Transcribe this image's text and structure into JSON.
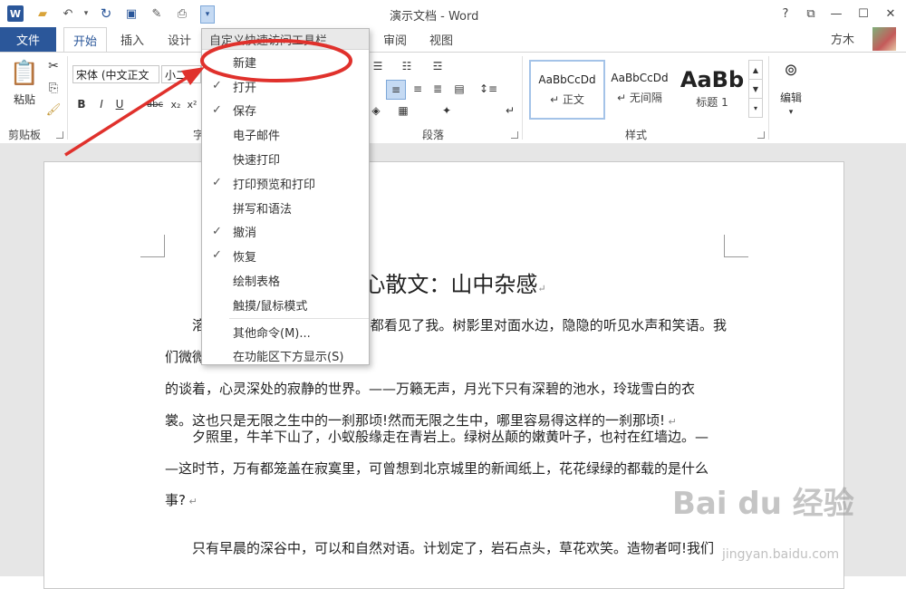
{
  "window": {
    "title": "演示文档 - Word",
    "user": "方木"
  },
  "tabs": {
    "file": "文件",
    "items": [
      "开始",
      "插入",
      "设计",
      "审阅",
      "视图"
    ],
    "active": "开始"
  },
  "ribbon": {
    "paste_label": "粘贴",
    "font_name": "宋体 (中文正文",
    "font_size": "小二",
    "groups": {
      "clipboard": "剪贴板",
      "font": "字",
      "paragraph": "段落",
      "styles": "样式"
    },
    "styles": [
      {
        "sample": "AaBbCcDd",
        "name": "↵ 正文"
      },
      {
        "sample": "AaBbCcDd",
        "name": "↵ 无间隔"
      },
      {
        "sample": "AaBb",
        "name": "标题 1"
      }
    ],
    "edit_label": "编辑"
  },
  "menu": {
    "header": "自定义快速访问工具栏",
    "items": [
      {
        "label": "新建",
        "checked": false
      },
      {
        "label": "打开",
        "checked": true
      },
      {
        "label": "保存",
        "checked": true
      },
      {
        "label": "电子邮件",
        "checked": false
      },
      {
        "label": "快速打印",
        "checked": false
      },
      {
        "label": "打印预览和打印",
        "checked": true
      },
      {
        "label": "拼写和语法",
        "checked": false
      },
      {
        "label": "撤消",
        "checked": true
      },
      {
        "label": "恢复",
        "checked": true
      },
      {
        "label": "绘制表格",
        "checked": false
      },
      {
        "label": "触摸/鼠标模式",
        "checked": false
      }
    ],
    "more": "其他命令(M)...",
    "below": "在功能区下方显示(S)"
  },
  "document": {
    "heading": "冰心散文：山中杂感",
    "p1_lines": [
      "溶溶的水月，螺髻的山峰，也都看见了我。树影里对面水边，隐隐的听见水声和笑语。我们微微",
      "的谈着，心灵深处的寂静的世界。——万籁无声，月光下只有深碧的池水，玲珑雪白的衣",
      "裳。这也只是无限之生中的一刹那顷!然而无限之生中，哪里容易得这样的一刹那顷!"
    ],
    "p2_lines": [
      "夕照里，牛羊下山了，小蚁般缘走在青岩上。绿树丛颠的嫩黄叶子，也衬在红墙边。—",
      "—这时节，万有都笼盖在寂寞里，可曾想到北京城里的新闻纸上，花花绿绿的都载的是什么",
      "事?"
    ],
    "p3_line": "只有早晨的深谷中，可以和自然对语。计划定了，岩石点头，草花欢笑。造物者呵!我们"
  },
  "watermark": {
    "main": "Bai du 经验",
    "sub": "jingyan.baidu.com"
  }
}
